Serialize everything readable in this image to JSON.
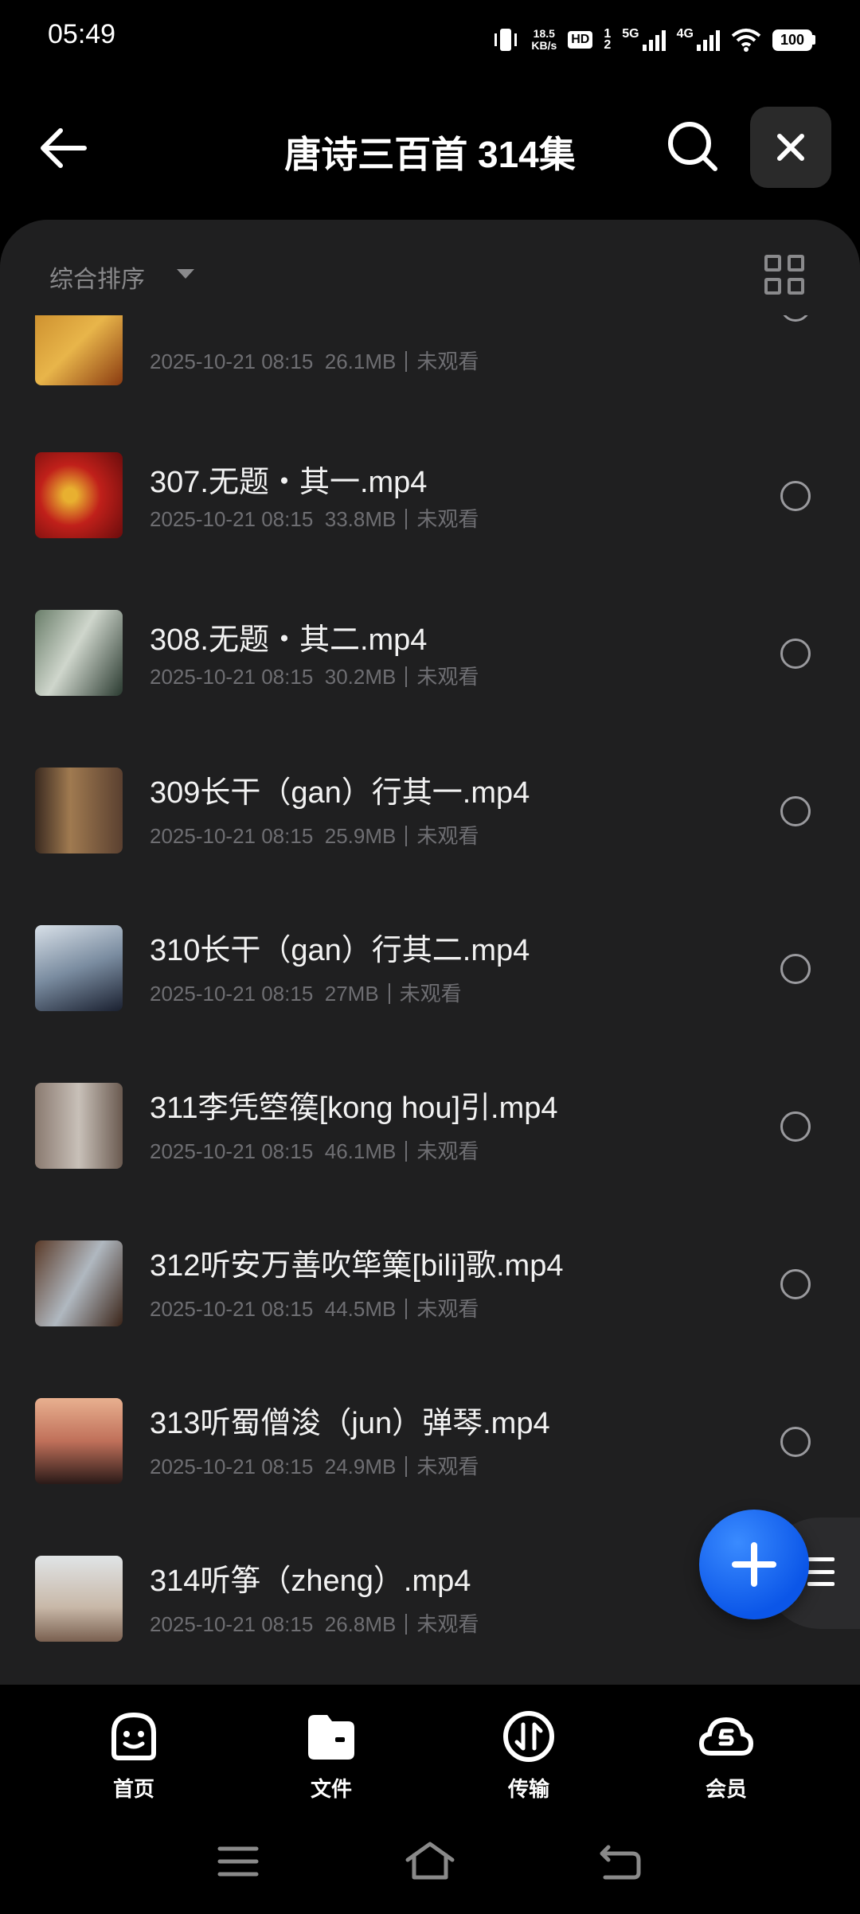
{
  "status": {
    "time": "05:49",
    "speed_value": "18.5",
    "speed_unit": "KB/s",
    "hd": "HD",
    "sim1": "1",
    "sim2": "2",
    "net1": "5G",
    "net2": "4G",
    "battery": "100"
  },
  "header": {
    "title": "唐诗三百首 314集"
  },
  "sort": {
    "label": "综合排序"
  },
  "files": [
    {
      "name": "",
      "date": "2025-10-21 08:15",
      "size": "26.1MB",
      "watched": "未观看"
    },
    {
      "name": "307.无题・其一.mp4",
      "date": "2025-10-21 08:15",
      "size": "33.8MB",
      "watched": "未观看"
    },
    {
      "name": "308.无题・其二.mp4",
      "date": "2025-10-21 08:15",
      "size": "30.2MB",
      "watched": "未观看"
    },
    {
      "name": "309长干（gan）行其一.mp4",
      "date": "2025-10-21 08:15",
      "size": "25.9MB",
      "watched": "未观看"
    },
    {
      "name": "310长干（gan）行其二.mp4",
      "date": "2025-10-21 08:15",
      "size": "27MB",
      "watched": "未观看"
    },
    {
      "name": "311李凭箜篌[kong hou]引.mp4",
      "date": "2025-10-21 08:15",
      "size": "46.1MB",
      "watched": "未观看"
    },
    {
      "name": "312听安万善吹筚篥[bili]歌.mp4",
      "date": "2025-10-21 08:15",
      "size": "44.5MB",
      "watched": "未观看"
    },
    {
      "name": "313听蜀僧浚（jun）弹琴.mp4",
      "date": "2025-10-21 08:15",
      "size": "24.9MB",
      "watched": "未观看"
    },
    {
      "name": "314听筝（zheng）.mp4",
      "date": "2025-10-21 08:15",
      "size": "26.8MB",
      "watched": "未观看"
    }
  ],
  "nav": {
    "home": "首页",
    "files": "文件",
    "transfer": "传输",
    "member": "会员"
  },
  "colors": {
    "fab": "#1463f3",
    "panel": "#1f1f20",
    "meta": "#6e6e72"
  }
}
